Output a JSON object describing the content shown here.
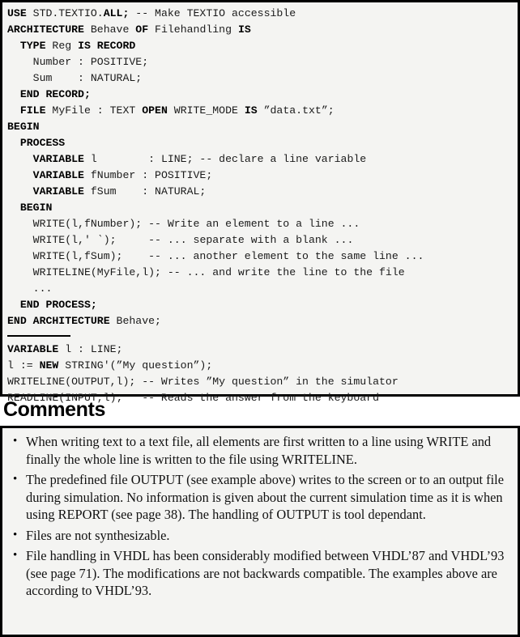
{
  "code_block_1": {
    "lines": [
      [
        {
          "t": "USE ",
          "b": true
        },
        {
          "t": "STD.TEXTIO.",
          "b": false
        },
        {
          "t": "ALL;",
          "b": true
        },
        {
          "t": " -- Make TEXTIO accessible",
          "b": false
        }
      ],
      [
        {
          "t": "ARCHITECTURE ",
          "b": true
        },
        {
          "t": "Behave ",
          "b": false
        },
        {
          "t": "OF ",
          "b": true
        },
        {
          "t": "Filehandling ",
          "b": false
        },
        {
          "t": "IS",
          "b": true
        }
      ],
      [
        {
          "t": "  TYPE ",
          "b": true
        },
        {
          "t": "Reg ",
          "b": false
        },
        {
          "t": "IS RECORD",
          "b": true
        }
      ],
      [
        {
          "t": "    Number : POSITIVE;",
          "b": false
        }
      ],
      [
        {
          "t": "    Sum    : NATURAL;",
          "b": false
        }
      ],
      [
        {
          "t": "  END RECORD;",
          "b": true
        }
      ],
      [
        {
          "t": "  FILE ",
          "b": true
        },
        {
          "t": "MyFile : TEXT ",
          "b": false
        },
        {
          "t": "OPEN ",
          "b": true
        },
        {
          "t": "WRITE_MODE ",
          "b": false
        },
        {
          "t": "IS ",
          "b": true
        },
        {
          "t": "”data.txt”;",
          "b": false
        }
      ],
      [
        {
          "t": "BEGIN",
          "b": true
        }
      ],
      [
        {
          "t": "  PROCESS",
          "b": true
        }
      ],
      [
        {
          "t": "    VARIABLE ",
          "b": true
        },
        {
          "t": "l        : LINE; -- declare a line variable",
          "b": false
        }
      ],
      [
        {
          "t": "    VARIABLE ",
          "b": true
        },
        {
          "t": "fNumber : POSITIVE;",
          "b": false
        }
      ],
      [
        {
          "t": "    VARIABLE ",
          "b": true
        },
        {
          "t": "fSum    : NATURAL;",
          "b": false
        }
      ],
      [
        {
          "t": "  BEGIN",
          "b": true
        }
      ],
      [
        {
          "t": "    WRITE(l,fNumber); -- Write an element to a line ...",
          "b": false
        }
      ],
      [
        {
          "t": "    WRITE(l,′ ‵);     -- ... separate with a blank ...",
          "b": false
        }
      ],
      [
        {
          "t": "    WRITE(l,fSum);    -- ... another element to the same line ...",
          "b": false
        }
      ],
      [
        {
          "t": "    WRITELINE(MyFile,l); -- ... and write the line to the file",
          "b": false
        }
      ],
      [
        {
          "t": "    ...",
          "b": false
        }
      ],
      [
        {
          "t": "  END PROCESS;",
          "b": true
        }
      ],
      [
        {
          "t": "END ARCHITECTURE ",
          "b": true
        },
        {
          "t": "Behave;",
          "b": false
        }
      ]
    ],
    "divider": "horizontal-rule",
    "lines_2": [
      [
        {
          "t": "VARIABLE ",
          "b": true
        },
        {
          "t": "l : LINE;",
          "b": false
        }
      ],
      [
        {
          "t": "l := ",
          "b": false
        },
        {
          "t": "NEW ",
          "b": true
        },
        {
          "t": "STRING′(”My question”);",
          "b": false
        }
      ],
      [
        {
          "t": "WRITELINE(OUTPUT,l); -- Writes ”My question” in the simulator",
          "b": false
        }
      ],
      [
        {
          "t": "READLINE(INPUT,l);   -- Reads the answer from the keyboard",
          "b": false
        }
      ]
    ]
  },
  "comments": {
    "heading": "Comments",
    "bullet_char": "•",
    "items": [
      "When writing text to a text file, all elements are first written to a line using WRITE and finally the whole line is written to the file using WRITELINE.",
      "The predefined file OUTPUT (see example above) writes to the screen or to an output file during simulation. No information is given about the current simulation time as it is when using REPORT (see page 38). The handling of OUTPUT is tool dependant.",
      "Files are not synthesizable.",
      "File handling in VHDL has been considerably modified between VHDL’87 and VHDL’93 (see page 71). The modifications are not backwards compatible. The examples above are according to VHDL’93."
    ]
  },
  "colors": {
    "border": "#000000",
    "box_background": "#f4f4f2",
    "code_text": "#1a1a1a",
    "body_text": "#111111"
  }
}
